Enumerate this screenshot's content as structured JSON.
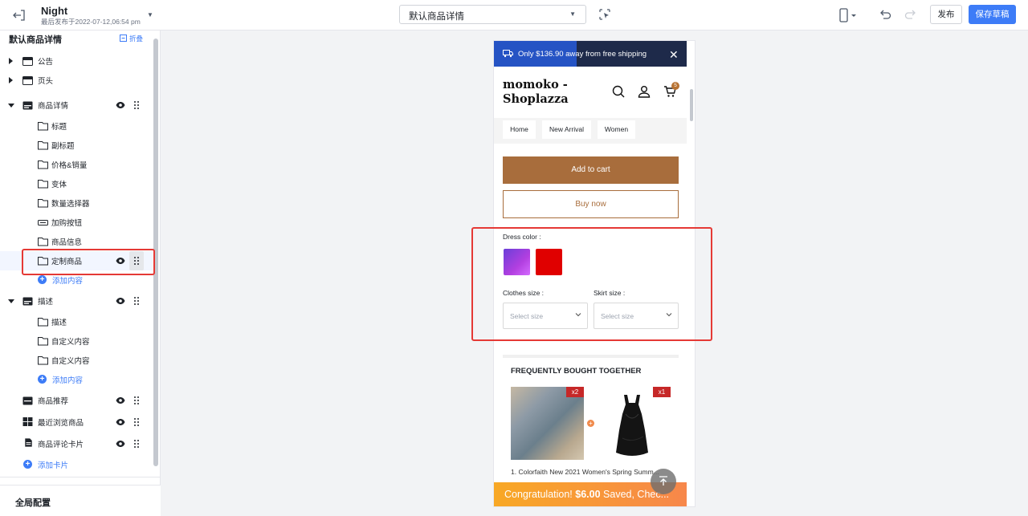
{
  "topbar": {
    "theme_name": "Night",
    "theme_sub": "最后发布于2022-07-12,06:54 pm",
    "page_select": "默认商品详情",
    "publish": "发布",
    "save_draft": "保存草稿"
  },
  "sidebar": {
    "title": "默认商品详情",
    "collapse": "折叠",
    "items": [
      {
        "label": "公告"
      },
      {
        "label": "页头"
      },
      {
        "label": "商品详情"
      },
      {
        "label": "标题"
      },
      {
        "label": "副标题"
      },
      {
        "label": "价格&销量"
      },
      {
        "label": "变体"
      },
      {
        "label": "数量选择器"
      },
      {
        "label": "加购按钮"
      },
      {
        "label": "商品信息"
      },
      {
        "label": "定制商品"
      },
      {
        "label": "添加内容"
      },
      {
        "label": "描述"
      },
      {
        "label": "描述"
      },
      {
        "label": "自定义内容"
      },
      {
        "label": "自定义内容"
      },
      {
        "label": "添加内容"
      },
      {
        "label": "商品推荐"
      },
      {
        "label": "最近浏览商品"
      },
      {
        "label": "商品评论卡片"
      },
      {
        "label": "添加卡片"
      }
    ],
    "global_config": "全局配置"
  },
  "preview": {
    "promo_text": "Only $136.90 away from free shipping",
    "logo": "momoko - Shoplazza",
    "cart_count": "5",
    "nav": [
      "Home",
      "New Arrival",
      "Women"
    ],
    "add_to_cart": "Add to cart",
    "buy_now": "Buy now",
    "dress_color_label": "Dress color :",
    "clothes_size_label": "Clothes size :",
    "skirt_size_label": "Skirt size :",
    "select_placeholder": "Select size",
    "fbt_title": "FREQUENTLY BOUGHT TOGETHER",
    "qty1": "x2",
    "qty2": "x1",
    "product_caption": "1. Colorfaith New 2021 Women's Spring Summ...",
    "congrats_prefix": "Congratulation!",
    "congrats_amount": "$6.00",
    "congrats_suffix": "Saved, Chec..."
  },
  "colors": {
    "accent": "#3d7cf7",
    "brand_button": "#a86d3c",
    "swatch_purple": "#8b3fe0",
    "swatch_red": "#e00000",
    "highlight": "#e53935"
  }
}
